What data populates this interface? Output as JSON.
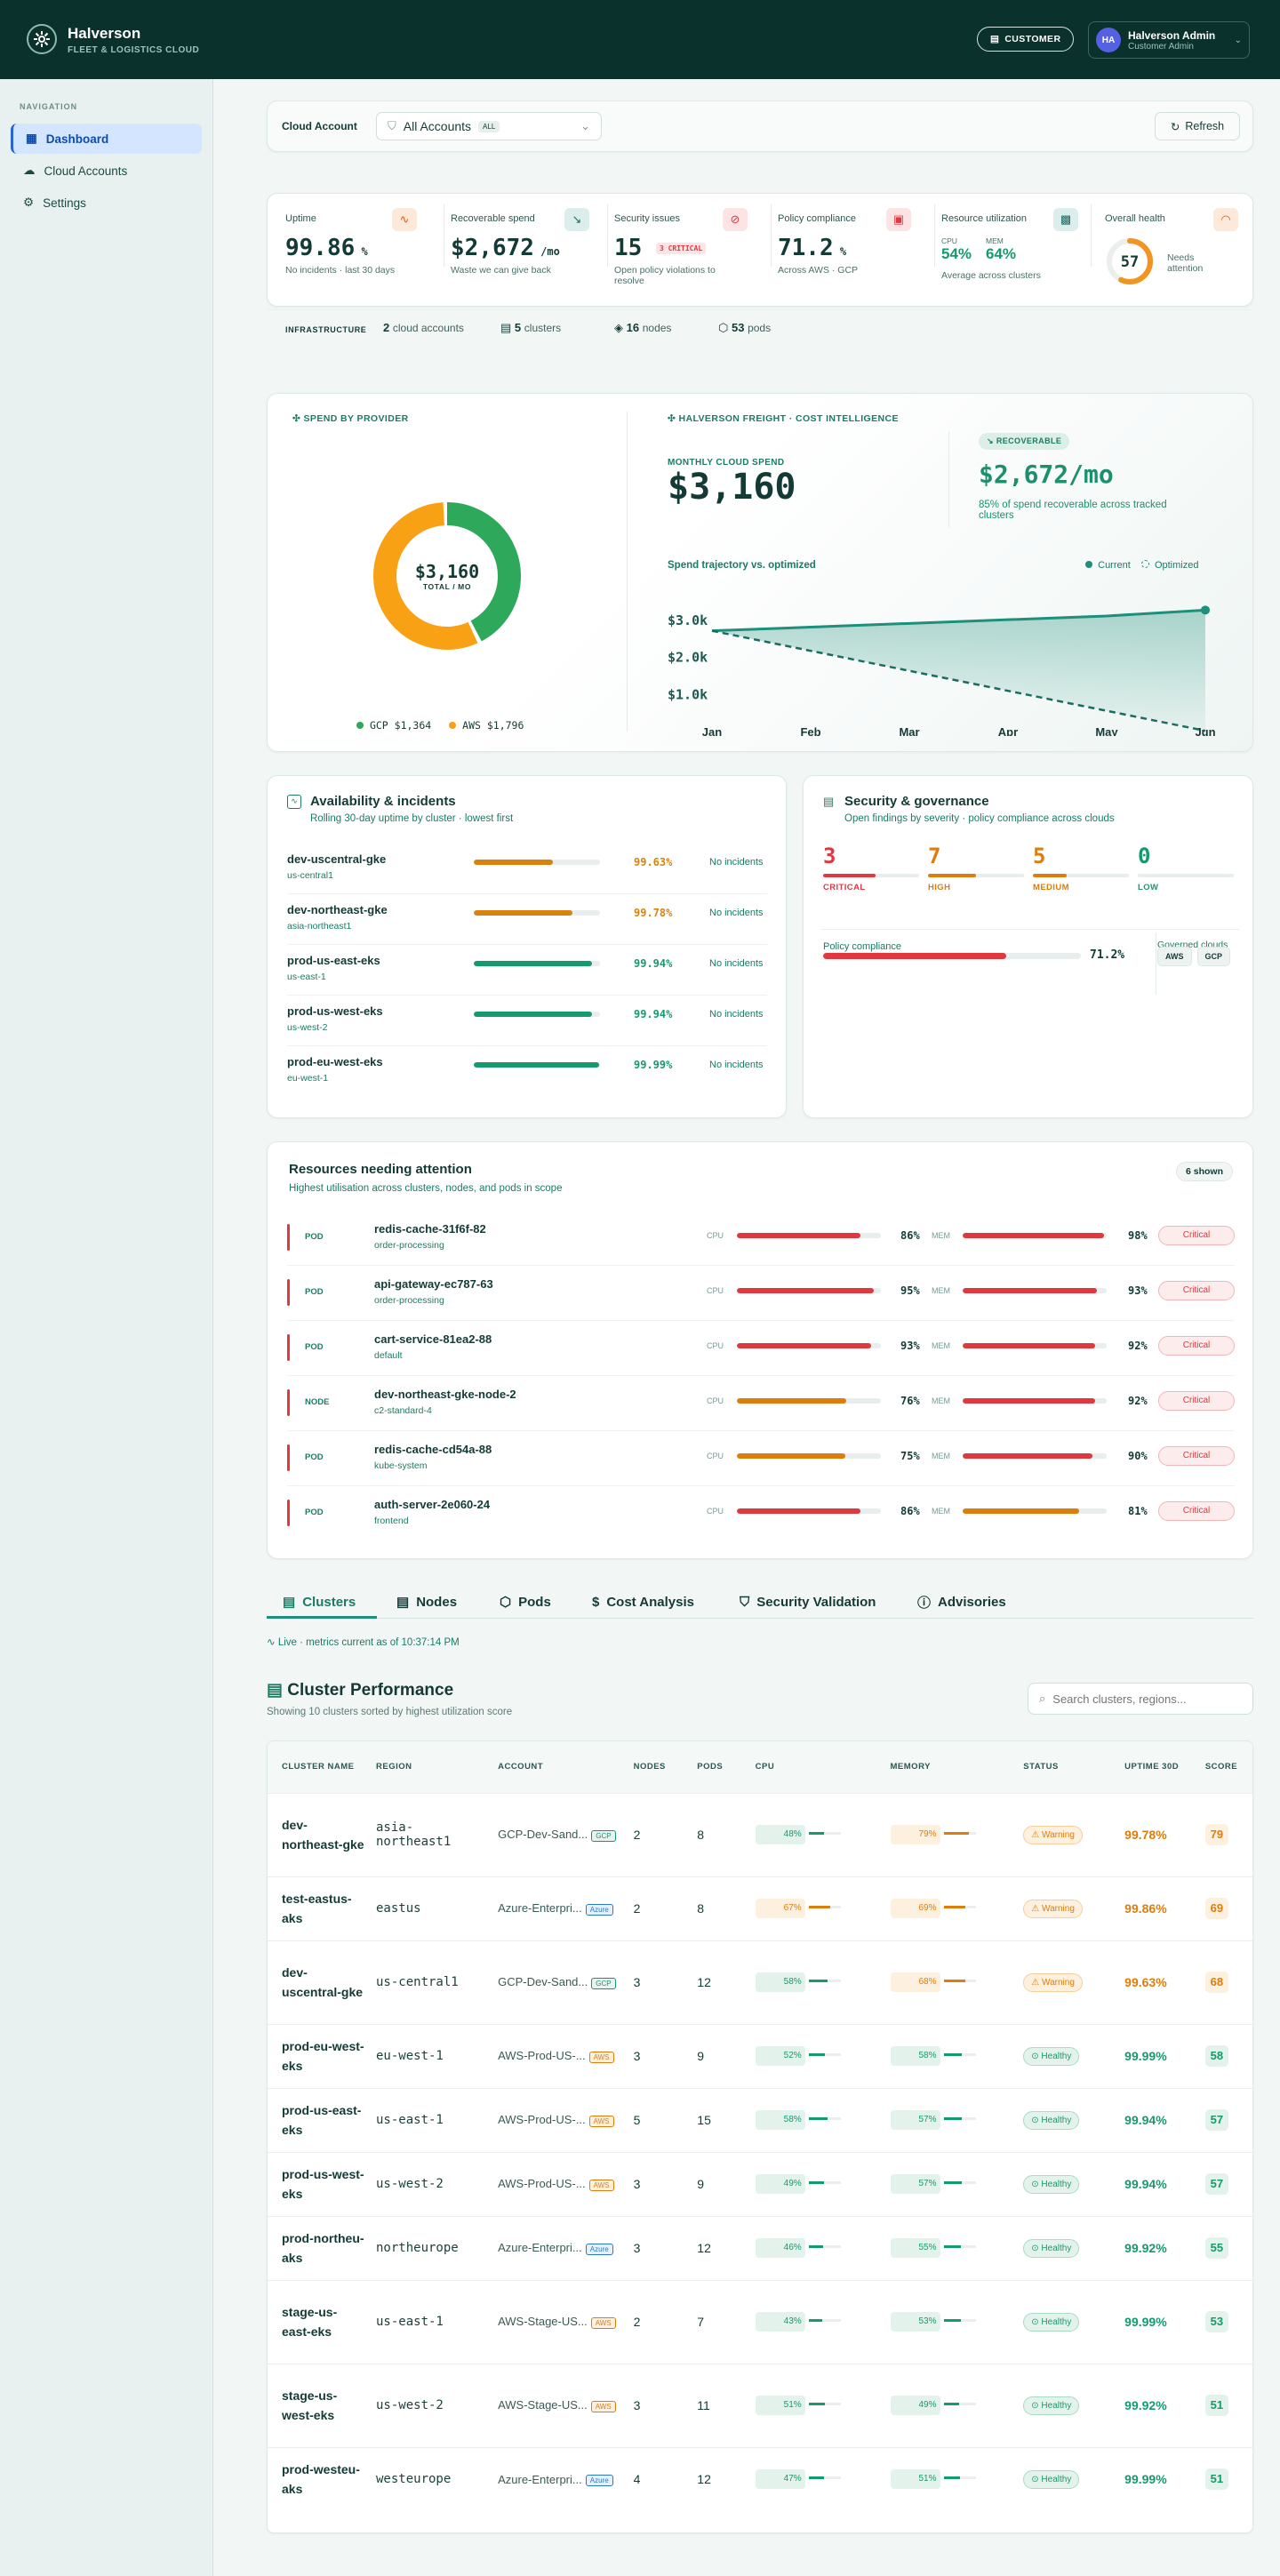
{
  "app": {
    "title": "Halverson",
    "subtitle": "FLEET & LOGISTICS CLOUD"
  },
  "header": {
    "customer_label": "CUSTOMER",
    "user_initials": "HA",
    "user_name": "Halverson Admin",
    "user_role": "Customer Admin"
  },
  "sidebar": {
    "heading": "NAVIGATION",
    "items": [
      {
        "label": "Dashboard"
      },
      {
        "label": "Cloud Accounts"
      },
      {
        "label": "Settings"
      }
    ]
  },
  "account_bar": {
    "label": "Cloud Account",
    "value": "All Accounts",
    "badge": "ALL",
    "refresh": "Refresh"
  },
  "kpis": {
    "uptime": {
      "title": "Uptime",
      "value": "99.86",
      "unit": "%",
      "sub": "No incidents · last 30 days"
    },
    "spend": {
      "title": "Recoverable spend",
      "value": "$2,672",
      "unit": "/mo",
      "sub": "Waste we can give back"
    },
    "security": {
      "title": "Security issues",
      "value": "15",
      "badge": "3 CRITICAL",
      "sub": "Open policy violations to resolve"
    },
    "compliance": {
      "title": "Policy compliance",
      "value": "71.2",
      "unit": "%",
      "sub": "Across AWS · GCP"
    },
    "resources": {
      "title": "Resource utilization",
      "cpu_label": "CPU",
      "cpu": "54%",
      "mem_label": "MEM",
      "mem": "64%",
      "sub": "Average across clusters"
    },
    "health": {
      "title": "Overall health",
      "value": "57",
      "sub": "Needs attention",
      "score": 57
    }
  },
  "infra": {
    "label": "INFRASTRUCTURE",
    "accounts_n": "2",
    "accounts_t": "cloud accounts",
    "clusters_n": "5",
    "clusters_t": "clusters",
    "nodes_n": "16",
    "nodes_t": "nodes",
    "pods_n": "53",
    "pods_t": "pods"
  },
  "spend_card": {
    "title": "SPEND BY PROVIDER",
    "total": "$3,160",
    "total_label": "TOTAL / MO",
    "legend": [
      {
        "name": "GCP",
        "value": "$1,364",
        "color": "#2ea85a"
      },
      {
        "name": "AWS",
        "value": "$1,796",
        "color": "#f9a114"
      }
    ],
    "share": [
      1364,
      1796
    ]
  },
  "intel": {
    "title": "HALVERSON FREIGHT · COST INTELLIGENCE",
    "monthly_label": "MONTHLY CLOUD SPEND",
    "monthly": "$3,160",
    "rec_badge": "RECOVERABLE",
    "rec_value": "$2,672/mo",
    "rec_sub": "85% of spend recoverable across tracked clusters",
    "traj_title": "Spend trajectory vs. optimized",
    "legend_current": "Current",
    "legend_opt": "Optimized"
  },
  "chart_data": {
    "type": "line",
    "x": [
      "Jan",
      "Feb",
      "Mar",
      "Apr",
      "May",
      "Jun"
    ],
    "y_ticks": [
      "$3.0k",
      "$2.0k",
      "$1.0k"
    ],
    "ylim": [
      0,
      3600
    ],
    "series": [
      {
        "name": "Current",
        "values": [
          2600,
          2700,
          2800,
          2900,
          3000,
          3160
        ]
      },
      {
        "name": "Optimized",
        "values": [
          2600,
          2060,
          1520,
          980,
          440,
          -100
        ]
      }
    ]
  },
  "availability": {
    "title": "Availability & incidents",
    "sub": "Rolling 30-day uptime by cluster · lowest first",
    "rows": [
      {
        "name": "dev-uscentral-gke",
        "region": "us-central1",
        "pct": "99.63%",
        "val": 0.63,
        "status": "No incidents",
        "color": "#d9820f"
      },
      {
        "name": "dev-northeast-gke",
        "region": "asia-northeast1",
        "pct": "99.78%",
        "val": 0.78,
        "status": "No incidents",
        "color": "#d9820f"
      },
      {
        "name": "prod-us-east-eks",
        "region": "us-east-1",
        "pct": "99.94%",
        "val": 0.94,
        "status": "No incidents",
        "color": "#159a6e"
      },
      {
        "name": "prod-us-west-eks",
        "region": "us-west-2",
        "pct": "99.94%",
        "val": 0.94,
        "status": "No incidents",
        "color": "#159a6e"
      },
      {
        "name": "prod-eu-west-eks",
        "region": "eu-west-1",
        "pct": "99.99%",
        "val": 0.99,
        "status": "No incidents",
        "color": "#159a6e"
      }
    ]
  },
  "security": {
    "title": "Security & governance",
    "sub": "Open findings by severity · policy compliance across clouds",
    "sev": [
      {
        "n": "3",
        "label": "CRITICAL",
        "color": "#e0383f",
        "fill": 0.55
      },
      {
        "n": "7",
        "label": "HIGH",
        "color": "#dc7d0c",
        "fill": 0.5
      },
      {
        "n": "5",
        "label": "MEDIUM",
        "color": "#dc7d0c",
        "fill": 0.35
      },
      {
        "n": "0",
        "label": "LOW",
        "color": "#159a6e",
        "fill": 0
      }
    ],
    "policy_label": "Policy compliance",
    "policy_value": "71.2%",
    "policy_fill": 0.712,
    "gov_label": "Governed clouds",
    "clouds": [
      "AWS",
      "GCP"
    ]
  },
  "attention": {
    "title": "Resources needing attention",
    "sub": "Highest utilisation across clusters, nodes, and pods in scope",
    "shown": "6 shown",
    "rows": [
      {
        "kind": "POD",
        "name": "redis-cache-31f6f-82",
        "ns": "order-processing",
        "cpu": "86%",
        "cpuv": 0.86,
        "mem": "98%",
        "memv": 0.98,
        "status": "Critical",
        "cpuc": "#e0383f",
        "memc": "#e0383f"
      },
      {
        "kind": "POD",
        "name": "api-gateway-ec787-63",
        "ns": "order-processing",
        "cpu": "95%",
        "cpuv": 0.95,
        "mem": "93%",
        "memv": 0.93,
        "status": "Critical",
        "cpuc": "#e0383f",
        "memc": "#e0383f"
      },
      {
        "kind": "POD",
        "name": "cart-service-81ea2-88",
        "ns": "default",
        "cpu": "93%",
        "cpuv": 0.93,
        "mem": "92%",
        "memv": 0.92,
        "status": "Critical",
        "cpuc": "#e0383f",
        "memc": "#e0383f"
      },
      {
        "kind": "NODE",
        "name": "dev-northeast-gke-node-2",
        "ns": "c2-standard-4",
        "cpu": "76%",
        "cpuv": 0.76,
        "mem": "92%",
        "memv": 0.92,
        "status": "Critical",
        "cpuc": "#dc7d0c",
        "memc": "#e0383f"
      },
      {
        "kind": "POD",
        "name": "redis-cache-cd54a-88",
        "ns": "kube-system",
        "cpu": "75%",
        "cpuv": 0.75,
        "mem": "90%",
        "memv": 0.9,
        "status": "Critical",
        "cpuc": "#dc7d0c",
        "memc": "#e0383f"
      },
      {
        "kind": "POD",
        "name": "auth-server-2e060-24",
        "ns": "frontend",
        "cpu": "86%",
        "cpuv": 0.86,
        "mem": "81%",
        "memv": 0.81,
        "status": "Critical",
        "cpuc": "#e0383f",
        "memc": "#dc7d0c"
      }
    ],
    "cpu_label": "CPU",
    "mem_label": "MEM"
  },
  "tabs": [
    "Clusters",
    "Nodes",
    "Pods",
    "Cost Analysis",
    "Security Validation",
    "Advisories"
  ],
  "live": "Live · metrics current as of 10:37:14 PM",
  "cluster_table": {
    "title": "Cluster Performance",
    "sub": "Showing 10 clusters sorted by highest utilization score",
    "search_placeholder": "Search clusters, regions...",
    "headers": [
      "CLUSTER NAME",
      "REGION",
      "ACCOUNT",
      "NODES",
      "PODS",
      "CPU",
      "MEMORY",
      "STATUS",
      "UPTIME 30D",
      "SCORE"
    ],
    "rows": [
      {
        "name": "dev-northeast-gke",
        "region": "asia-northeast1",
        "account": "GCP-Dev-Sand...",
        "cloud": "GCP",
        "nodes": "2",
        "pods": "8",
        "cpu": "48%",
        "cpuv": 0.48,
        "mem": "79%",
        "memv": 0.79,
        "status": "Warning",
        "uptime": "99.78%",
        "score": "79"
      },
      {
        "name": "test-eastus-aks",
        "region": "eastus",
        "account": "Azure-Enterpri...",
        "cloud": "Azure",
        "nodes": "2",
        "pods": "8",
        "cpu": "67%",
        "cpuv": 0.67,
        "mem": "69%",
        "memv": 0.69,
        "status": "Warning",
        "uptime": "99.86%",
        "score": "69"
      },
      {
        "name": "dev-uscentral-gke",
        "region": "us-central1",
        "account": "GCP-Dev-Sand...",
        "cloud": "GCP",
        "nodes": "3",
        "pods": "12",
        "cpu": "58%",
        "cpuv": 0.58,
        "mem": "68%",
        "memv": 0.68,
        "status": "Warning",
        "uptime": "99.63%",
        "score": "68"
      },
      {
        "name": "prod-eu-west-eks",
        "region": "eu-west-1",
        "account": "AWS-Prod-US-...",
        "cloud": "AWS",
        "nodes": "3",
        "pods": "9",
        "cpu": "52%",
        "cpuv": 0.52,
        "mem": "58%",
        "memv": 0.58,
        "status": "Healthy",
        "uptime": "99.99%",
        "score": "58"
      },
      {
        "name": "prod-us-east-eks",
        "region": "us-east-1",
        "account": "AWS-Prod-US-...",
        "cloud": "AWS",
        "nodes": "5",
        "pods": "15",
        "cpu": "58%",
        "cpuv": 0.58,
        "mem": "57%",
        "memv": 0.57,
        "status": "Healthy",
        "uptime": "99.94%",
        "score": "57"
      },
      {
        "name": "prod-us-west-eks",
        "region": "us-west-2",
        "account": "AWS-Prod-US-...",
        "cloud": "AWS",
        "nodes": "3",
        "pods": "9",
        "cpu": "49%",
        "cpuv": 0.49,
        "mem": "57%",
        "memv": 0.57,
        "status": "Healthy",
        "uptime": "99.94%",
        "score": "57"
      },
      {
        "name": "prod-northeu-aks",
        "region": "northeurope",
        "account": "Azure-Enterpri...",
        "cloud": "Azure",
        "nodes": "3",
        "pods": "12",
        "cpu": "46%",
        "cpuv": 0.46,
        "mem": "55%",
        "memv": 0.55,
        "status": "Healthy",
        "uptime": "99.92%",
        "score": "55"
      },
      {
        "name": "stage-us-east-eks",
        "region": "us-east-1",
        "account": "AWS-Stage-US...",
        "cloud": "AWS",
        "nodes": "2",
        "pods": "7",
        "cpu": "43%",
        "cpuv": 0.43,
        "mem": "53%",
        "memv": 0.53,
        "status": "Healthy",
        "uptime": "99.99%",
        "score": "53"
      },
      {
        "name": "stage-us-west-eks",
        "region": "us-west-2",
        "account": "AWS-Stage-US...",
        "cloud": "AWS",
        "nodes": "3",
        "pods": "11",
        "cpu": "51%",
        "cpuv": 0.51,
        "mem": "49%",
        "memv": 0.49,
        "status": "Healthy",
        "uptime": "99.92%",
        "score": "51"
      },
      {
        "name": "prod-westeu-aks",
        "region": "westeurope",
        "account": "Azure-Enterpri...",
        "cloud": "Azure",
        "nodes": "4",
        "pods": "12",
        "cpu": "47%",
        "cpuv": 0.47,
        "mem": "51%",
        "memv": 0.51,
        "status": "Healthy",
        "uptime": "99.99%",
        "score": "51"
      }
    ]
  }
}
